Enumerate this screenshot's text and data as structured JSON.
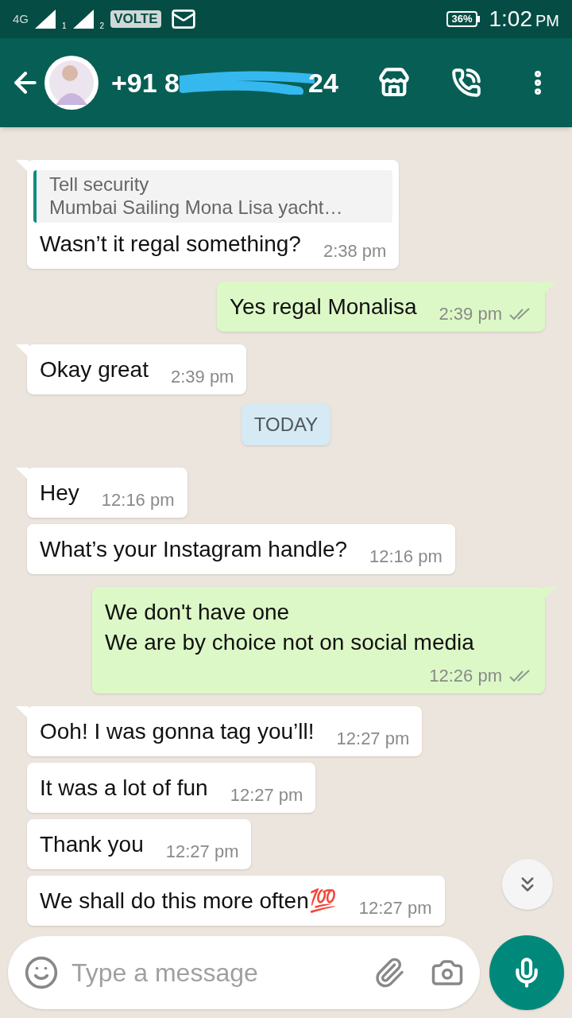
{
  "status_bar": {
    "network": "4G",
    "sim_1": "1",
    "sim_2": "2",
    "volte": "VOLTE",
    "battery": "36%",
    "time": "1:02",
    "ampm": "PM"
  },
  "header": {
    "title_start": "+91 8",
    "title_end": "24"
  },
  "messages": [
    {
      "kind": "incoming",
      "quote": {
        "title": "Tell security",
        "text": "Mumbai Sailing Mona Lisa yacht…"
      },
      "text": "Wasn’t it regal something?",
      "time": "2:38 pm"
    },
    {
      "kind": "outgoing",
      "text": "Yes regal Monalisa",
      "time": "2:39 pm",
      "read": false
    },
    {
      "kind": "incoming",
      "text": "Okay great",
      "time": "2:39 pm"
    },
    {
      "kind": "date",
      "text": "TODAY"
    },
    {
      "kind": "incoming",
      "text": "Hey",
      "time": "12:16 pm"
    },
    {
      "kind": "incoming",
      "text": "What’s your Instagram handle?",
      "time": "12:16 pm"
    },
    {
      "kind": "outgoing",
      "text": "We don't have one\nWe are by choice not on social media",
      "time": "12:26 pm",
      "read": false
    },
    {
      "kind": "incoming",
      "text": "Ooh! I was gonna tag you’ll!",
      "time": "12:27 pm"
    },
    {
      "kind": "incoming",
      "text": "It was a lot of fun",
      "time": "12:27 pm"
    },
    {
      "kind": "incoming",
      "text": "Thank you",
      "time": "12:27 pm"
    },
    {
      "kind": "incoming",
      "text": "We shall do this more often💯",
      "time": "12:27 pm"
    }
  ],
  "composer": {
    "placeholder": "Type a message"
  }
}
